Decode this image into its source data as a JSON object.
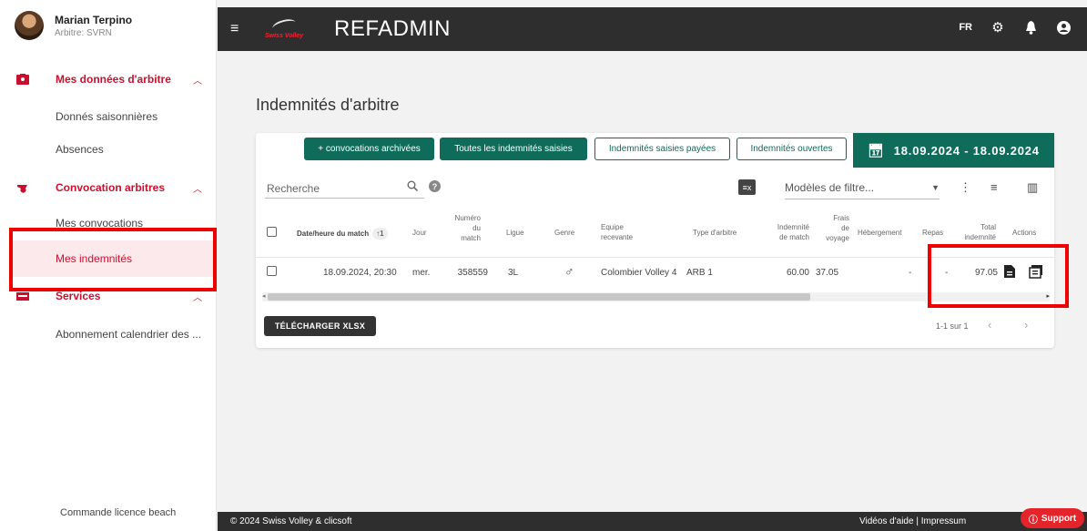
{
  "user": {
    "name": "Marian Terpino",
    "role": "Arbitre: SVRN"
  },
  "sidebar": {
    "sections": [
      {
        "label": "Mes données d'arbitre",
        "items": [
          "Donnés saisonnières",
          "Absences"
        ]
      },
      {
        "label": "Convocation arbitres",
        "items": [
          "Mes convocations",
          "Mes indemnités"
        ]
      },
      {
        "label": "Services",
        "items": [
          "Abonnement calendrier des ..."
        ]
      }
    ],
    "footer": "Commande licence beach"
  },
  "topbar": {
    "title": "REFADMIN",
    "logo_text": "Swiss Volley",
    "lang": "FR"
  },
  "page": {
    "title": "Indemnités d'arbitre"
  },
  "toolbar": {
    "buttons": [
      "+ convocations archivées",
      "Toutes les indemnités saisies",
      "Indemnités saisies payées",
      "Indemnités ouvertes"
    ],
    "date_range": "18.09.2024 - 18.09.2024",
    "search_placeholder": "Recherche",
    "filter_placeholder": "Modèles de filtre..."
  },
  "table": {
    "headers": {
      "date": "Date/heure du match",
      "sort_badge": "↑1",
      "jour": "Jour",
      "numero": [
        "Numéro",
        "du",
        "match"
      ],
      "ligue": "Ligue",
      "genre": "Genre",
      "equipe": [
        "Equipe",
        "recevante"
      ],
      "type": "Type d'arbitre",
      "indemnite": [
        "Indemnité",
        "de match"
      ],
      "frais": [
        "Frais",
        "de",
        "voyage"
      ],
      "hebergement": "Hébergement",
      "repas": "Repas",
      "total": [
        "Total",
        "indemnité"
      ],
      "actions": "Actions"
    },
    "row": {
      "date": "18.09.2024, 20:30",
      "jour": "mer.",
      "numero": "358559",
      "ligue": "3L",
      "genre": "♂",
      "equipe": "Colombier Volley 4",
      "type": "ARB 1",
      "indemnite": "60.00",
      "frais": "37.05",
      "hebergement": "-",
      "repas": "-",
      "total": "97.05"
    }
  },
  "bottom": {
    "download": "TÉLÉCHARGER XLSX",
    "pager": "1-1 sur 1"
  },
  "footer": {
    "copyright": "© 2024 Swiss Volley & clicsoft",
    "links": "Vidéos d'aide  |  Impressum",
    "support": "Support"
  },
  "colors": {
    "accent": "#c8102e",
    "primary": "#0f6b5a",
    "topbar": "#2e2e2e",
    "highlight": "#ee0000"
  }
}
